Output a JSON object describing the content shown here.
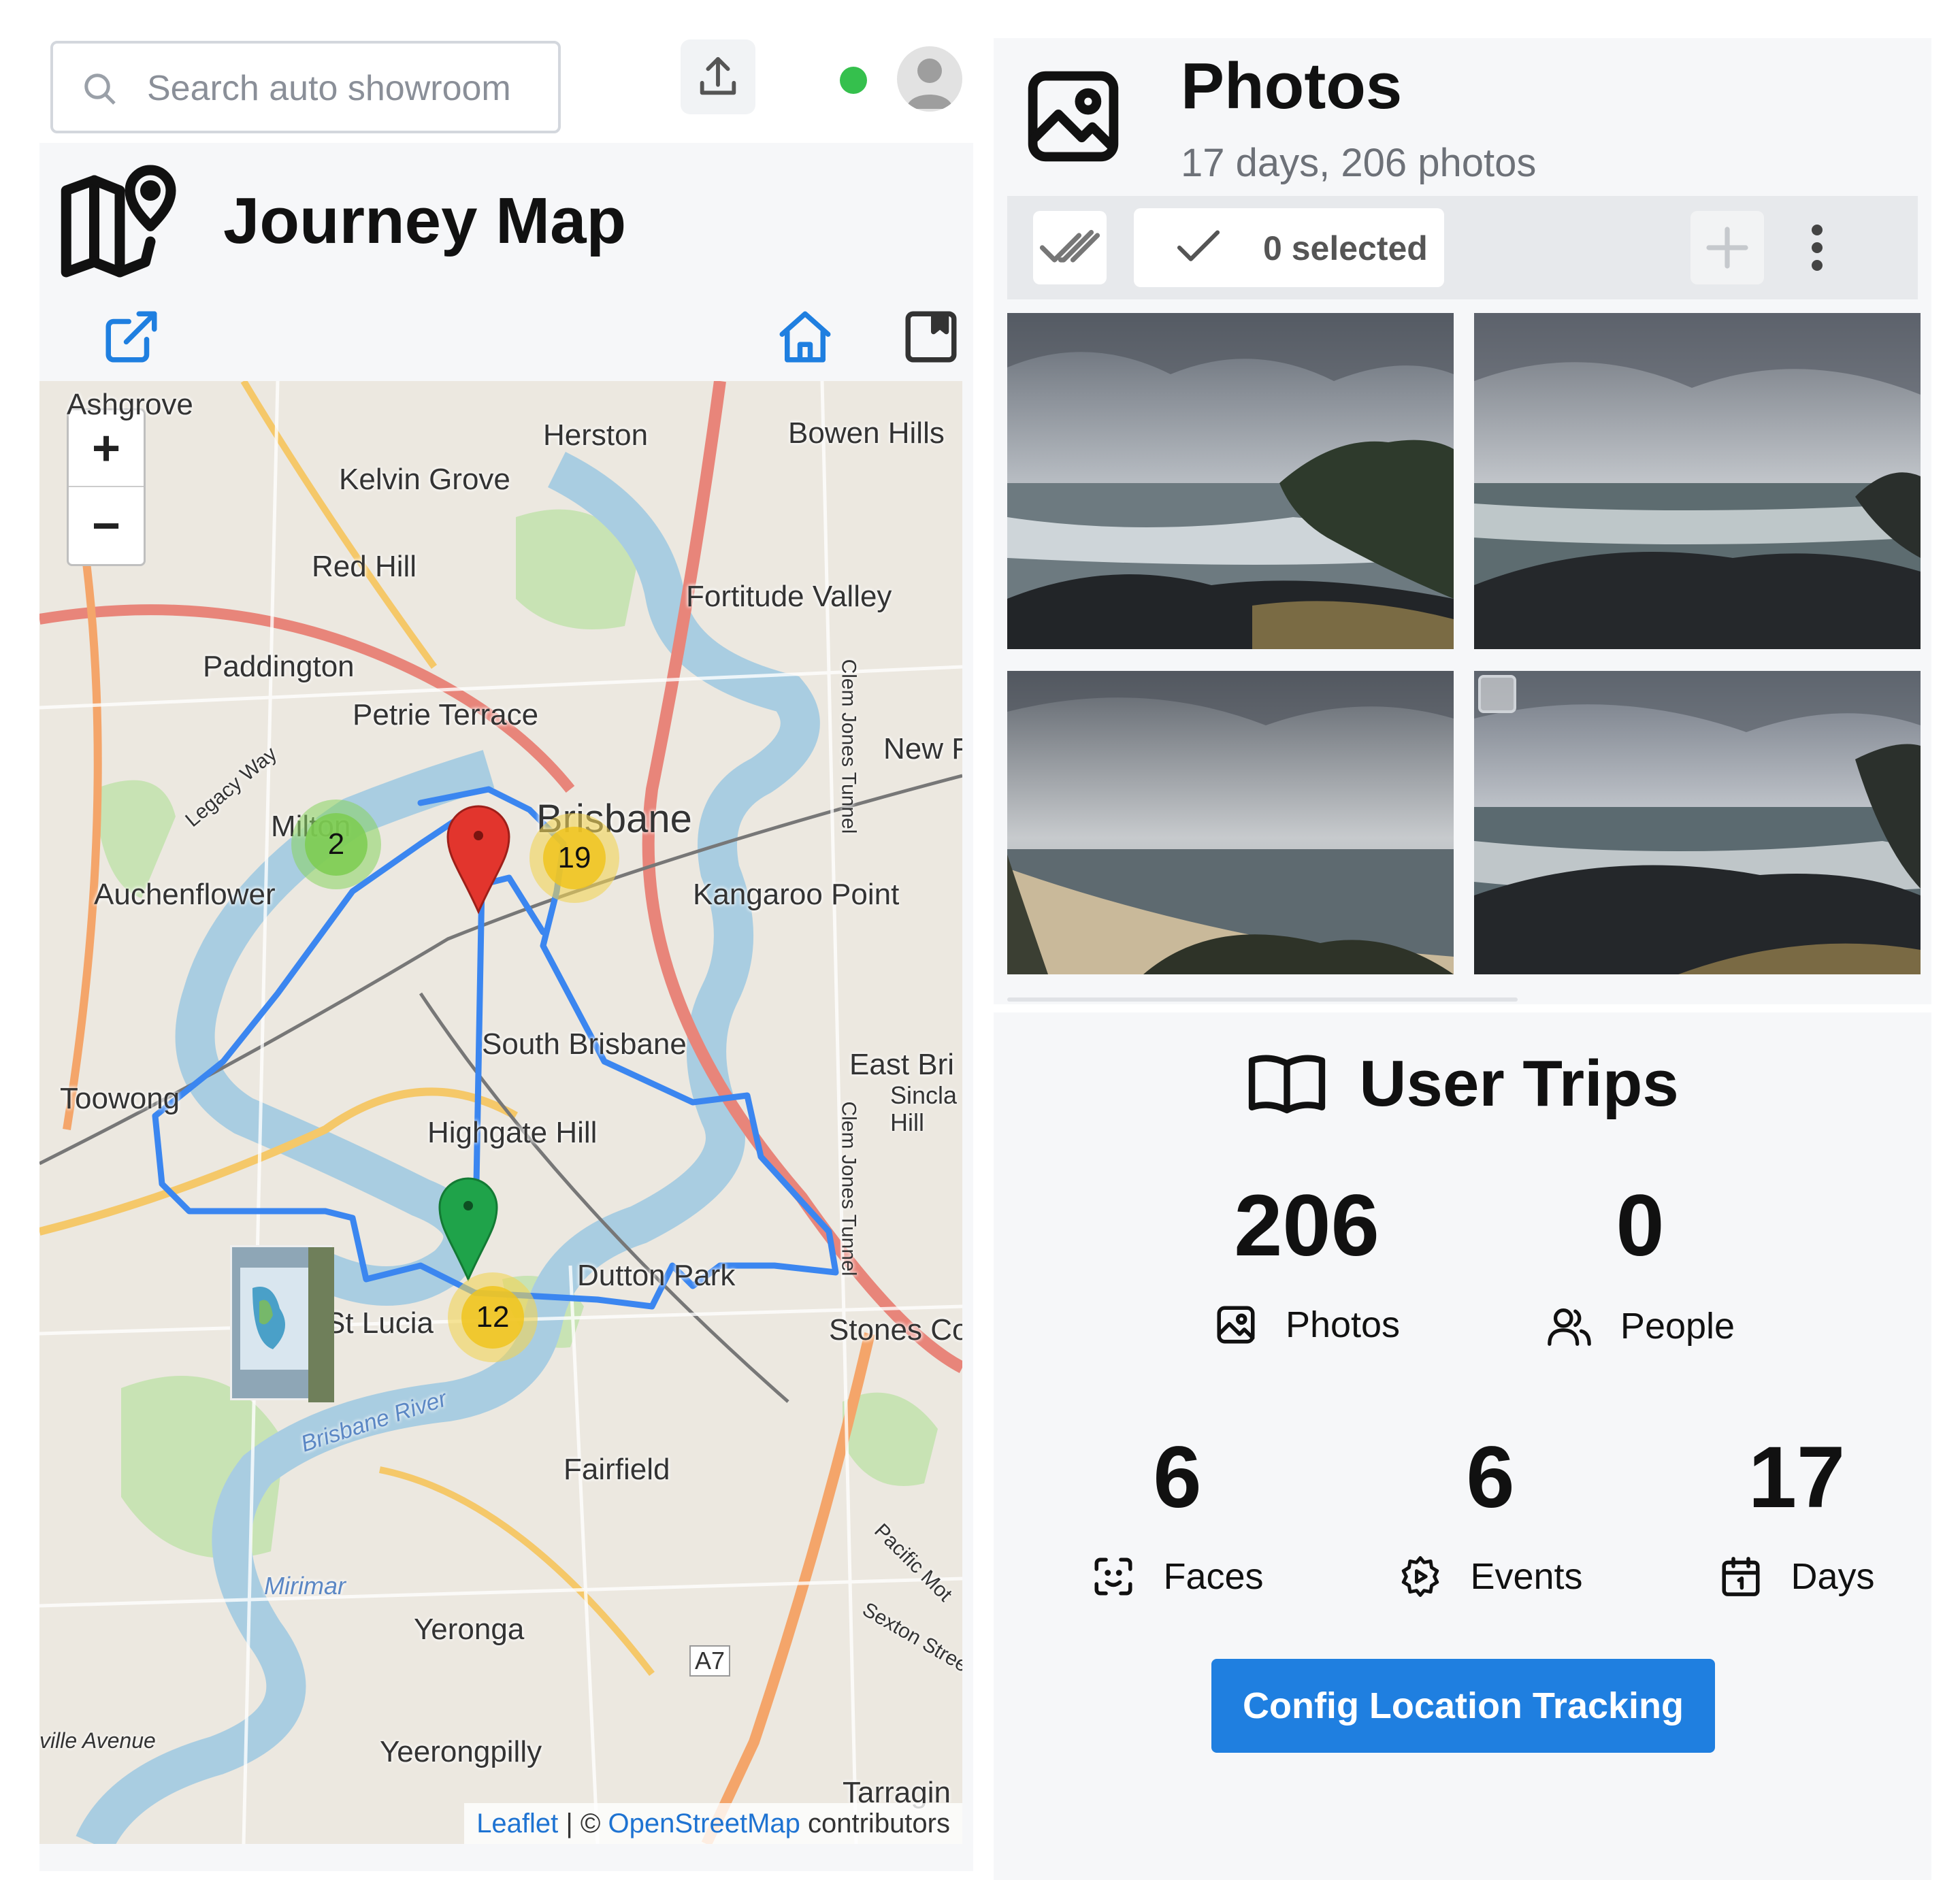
{
  "search": {
    "placeholder": "Search auto showroom"
  },
  "journey": {
    "title": "Journey Map"
  },
  "map": {
    "zoom_in": "+",
    "zoom_out": "−",
    "labels": {
      "ashgrove": "Ashgrove",
      "herston": "Herston",
      "bowen_hills": "Bowen Hills",
      "kelvin_grove": "Kelvin Grove",
      "red_hill": "Red Hill",
      "fortitude_valley": "Fortitude Valley",
      "paddington": "Paddington",
      "petrie_terrace": "Petrie Terrace",
      "new_farm": "New F",
      "legacy_way": "Legacy Way",
      "milton": "Milton",
      "brisbane": "Brisbane",
      "auchenflower": "Auchenflower",
      "kangaroo_point": "Kangaroo Point",
      "south_brisbane": "South Brisbane",
      "east_brisbane": "East Bri",
      "sinclair_hill": "Sincla Hill",
      "toowong": "Toowong",
      "highgate_hill": "Highgate Hill",
      "dutton_park": "Dutton Park",
      "st_lucia": "St Lucia",
      "stones_corner": "Stones Co",
      "brisbane_river": "Brisbane River",
      "fairfield": "Fairfield",
      "clem_jones_tunnel_1": "Clem Jones Tunnel",
      "clem_jones_tunnel_2": "Clem Jones Tunnel",
      "mirimar": "Mirimar",
      "yeronga": "Yeronga",
      "pacific_motorway": "Pacific Mot",
      "sexton_street": "Sexton Stree",
      "a7": "A7",
      "ville_avenue": "ville Avenue",
      "yeerongpilly": "Yeerongpilly",
      "tarragindi": "Tarragin"
    },
    "clusters": [
      {
        "count": "2",
        "color": "green"
      },
      {
        "count": "19",
        "color": "yellow"
      },
      {
        "count": "12",
        "color": "yellow"
      }
    ],
    "attribution": {
      "leaflet": "Leaflet",
      "sep": " | © ",
      "osm": "OpenStreetMap",
      "contributors": " contributors"
    }
  },
  "photos": {
    "title": "Photos",
    "subtitle": "17 days, 206 photos",
    "selected": "0 selected"
  },
  "trips": {
    "title": "User Trips",
    "stats": [
      {
        "value": "206",
        "label": "Photos",
        "icon": "image-icon"
      },
      {
        "value": "0",
        "label": "People",
        "icon": "people-icon"
      },
      {
        "value": "6",
        "label": "Faces",
        "icon": "face-scan-icon"
      },
      {
        "value": "6",
        "label": "Events",
        "icon": "event-gear-icon"
      },
      {
        "value": "17",
        "label": "Days",
        "icon": "calendar-icon"
      }
    ],
    "config_button": "Config Location Tracking"
  },
  "colors": {
    "accent": "#1f7fe0",
    "route": "#3b86f0",
    "status_online": "#35c04d",
    "start_marker": "#1fa34a",
    "end_marker": "#e2352d"
  }
}
